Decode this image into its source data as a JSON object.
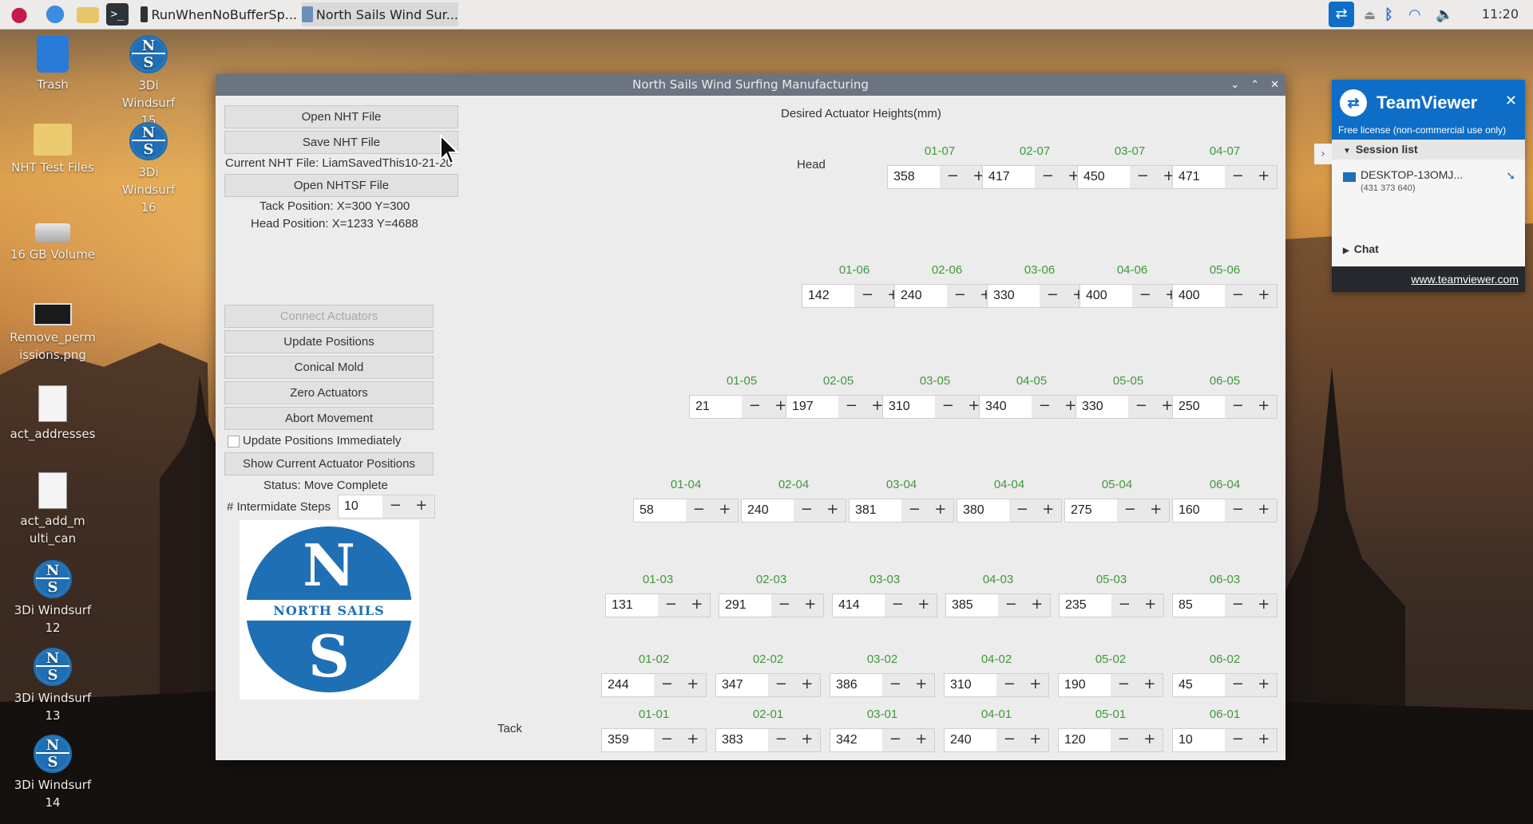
{
  "taskbar": {
    "tasks": [
      "RunWhenNoBufferSp...",
      "North Sails Wind Sur..."
    ],
    "clock": "11:20"
  },
  "desktop": {
    "icons": [
      {
        "label": "Trash",
        "icon": "trash-icon"
      },
      {
        "label": "3Di Windsurf 15",
        "icon": "north-sails-icon"
      },
      {
        "label": "NHT Test Files",
        "icon": "folder-icon"
      },
      {
        "label": "3Di Windsurf 16",
        "icon": "north-sails-icon"
      },
      {
        "label": "16 GB Volume",
        "icon": "drive-icon"
      },
      {
        "label": "Remove_permissions.png",
        "icon": "image-file-icon"
      },
      {
        "label": "act_addresses",
        "icon": "text-file-icon"
      },
      {
        "label": "act_add_multi_can",
        "icon": "text-file-icon"
      },
      {
        "label": "3Di Windsurf 12",
        "icon": "north-sails-icon"
      },
      {
        "label": "3Di Windsurf 13",
        "icon": "north-sails-icon"
      },
      {
        "label": "3Di Windsurf 14",
        "icon": "north-sails-icon"
      }
    ]
  },
  "window": {
    "title": "North Sails Wind Surfing Manufacturing",
    "left": {
      "open_nht": "Open NHT File",
      "save_nht": "Save NHT File",
      "current_file": "Current NHT File: LiamSavedThis10-21-20",
      "open_nhtsf": "Open NHTSF File",
      "tack_position": "Tack Position: X=300   Y=300",
      "head_position": "Head Position: X=1233   Y=4688",
      "connect": "Connect Actuators",
      "update": "Update Positions",
      "conical": "Conical Mold",
      "zero": "Zero Actuators",
      "abort": "Abort Movement",
      "update_immediately": "Update Positions Immediately",
      "show_current": "Show Current Actuator Positions",
      "status": "Status: Move Complete",
      "steps_label": "# Intermidate Steps",
      "steps_value": "10",
      "logo_text": "NORTH SAILS"
    },
    "grid_title": "Desired Actuator Heights(mm)",
    "head_label": "Head",
    "tack_label": "Tack",
    "rows": [
      {
        "cells": [
          [
            "01-07",
            "358"
          ],
          [
            "02-07",
            "417"
          ],
          [
            "03-07",
            "450"
          ],
          [
            "04-07",
            "471"
          ]
        ]
      },
      {
        "cells": [
          [
            "01-06",
            "142"
          ],
          [
            "02-06",
            "240"
          ],
          [
            "03-06",
            "330"
          ],
          [
            "04-06",
            "400"
          ],
          [
            "05-06",
            "400"
          ]
        ]
      },
      {
        "cells": [
          [
            "01-05",
            "21"
          ],
          [
            "02-05",
            "197"
          ],
          [
            "03-05",
            "310"
          ],
          [
            "04-05",
            "340"
          ],
          [
            "05-05",
            "330"
          ],
          [
            "06-05",
            "250"
          ]
        ]
      },
      {
        "cells": [
          [
            "01-04",
            "58"
          ],
          [
            "02-04",
            "240"
          ],
          [
            "03-04",
            "381"
          ],
          [
            "04-04",
            "380"
          ],
          [
            "05-04",
            "275"
          ],
          [
            "06-04",
            "160"
          ]
        ]
      },
      {
        "cells": [
          [
            "01-03",
            "131"
          ],
          [
            "02-03",
            "291"
          ],
          [
            "03-03",
            "414"
          ],
          [
            "04-03",
            "385"
          ],
          [
            "05-03",
            "235"
          ],
          [
            "06-03",
            "85"
          ]
        ]
      },
      {
        "cells": [
          [
            "01-02",
            "244"
          ],
          [
            "02-02",
            "347"
          ],
          [
            "03-02",
            "386"
          ],
          [
            "04-02",
            "310"
          ],
          [
            "05-02",
            "190"
          ],
          [
            "06-02",
            "45"
          ]
        ]
      },
      {
        "cells": [
          [
            "01-01",
            "359"
          ],
          [
            "02-01",
            "383"
          ],
          [
            "03-01",
            "342"
          ],
          [
            "04-01",
            "240"
          ],
          [
            "05-01",
            "120"
          ],
          [
            "06-01",
            "10"
          ]
        ]
      }
    ]
  },
  "teamviewer": {
    "brand": "TeamViewer",
    "license": "Free license (non-commercial use only)",
    "session_list": "Session list",
    "device": "DESKTOP-13OMJ...",
    "device_id": "(431 373 640)",
    "chat": "Chat",
    "link": "www.teamviewer.com"
  },
  "colors": {
    "accent_green": "#3f9a3a",
    "teamviewer_blue": "#0e6ec7",
    "north_sails_blue": "#1f6fb5"
  }
}
